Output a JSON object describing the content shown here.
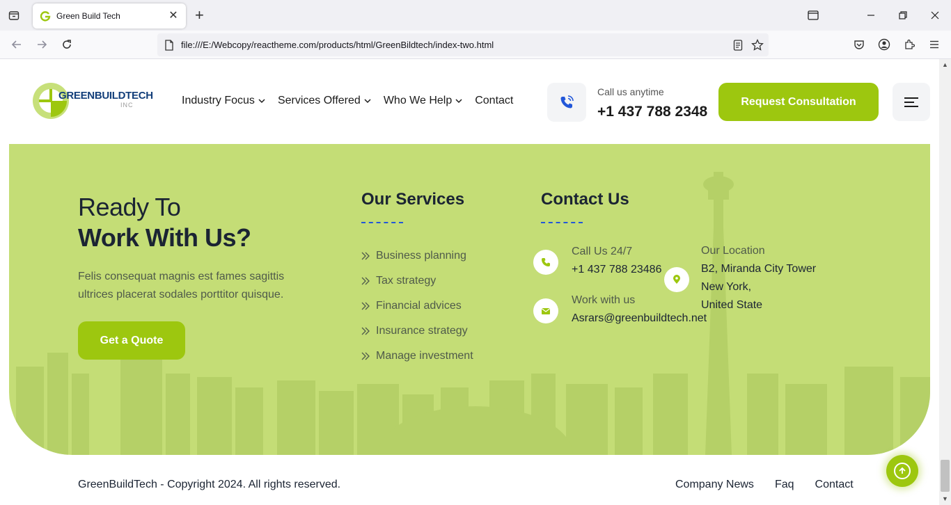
{
  "browser": {
    "tab_title": "Green Build Tech",
    "url": "file:///E:/Webcopy/reactheme.com/products/html/GreenBildtech/index-two.html"
  },
  "header": {
    "logo_text": "GREENBUILDTECH",
    "logo_sub": "INC",
    "menu": [
      {
        "label": "Industry Focus",
        "has_dropdown": true
      },
      {
        "label": "Services Offered",
        "has_dropdown": true
      },
      {
        "label": "Who We Help",
        "has_dropdown": true
      },
      {
        "label": "Contact",
        "has_dropdown": false
      }
    ],
    "call_label": "Call us anytime",
    "call_number": "+1 437 788 2348",
    "cta_button": "Request Consultation"
  },
  "cta": {
    "heading_line1": "Ready To",
    "heading_line2": "Work With Us?",
    "description": "Felis consequat magnis est fames sagittis ultrices placerat sodales porttitor quisque.",
    "quote_button": "Get a Quote",
    "services_title": "Our Services",
    "services": [
      "Business planning",
      "Tax strategy",
      "Financial advices",
      "Insurance strategy",
      "Manage investment"
    ],
    "contact_title": "Contact Us",
    "contact": {
      "call_label": "Call Us 24/7",
      "call_value": "+1 437 788 23486",
      "work_label": "Work with us",
      "work_value": "Asrars@greenbuildtech.net",
      "location_label": "Our Location",
      "location_line1": "B2, Miranda City Tower",
      "location_line2": "New York,",
      "location_line3": "United State"
    }
  },
  "footer": {
    "copyright": "GreenBuildTech - Copyright 2024. All rights reserved.",
    "links": [
      "Company News",
      "Faq",
      "Contact"
    ]
  },
  "colors": {
    "accent": "#9dc70f",
    "cta_bg": "#c4dd76",
    "heading": "#1b2433",
    "underline": "#2257d9"
  }
}
